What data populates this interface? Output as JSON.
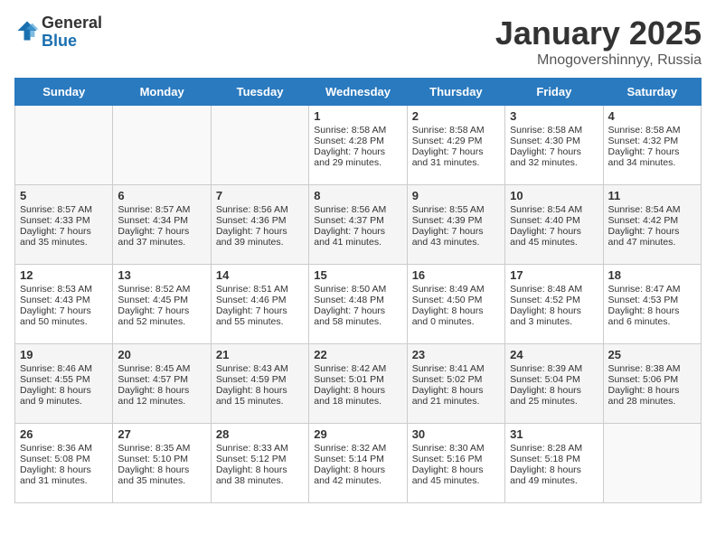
{
  "header": {
    "logo": {
      "general": "General",
      "blue": "Blue"
    },
    "title": "January 2025",
    "subtitle": "Mnogovershinnyy, Russia"
  },
  "weekdays": [
    "Sunday",
    "Monday",
    "Tuesday",
    "Wednesday",
    "Thursday",
    "Friday",
    "Saturday"
  ],
  "weeks": [
    [
      {
        "day": "",
        "content": ""
      },
      {
        "day": "",
        "content": ""
      },
      {
        "day": "",
        "content": ""
      },
      {
        "day": "1",
        "content": "Sunrise: 8:58 AM\nSunset: 4:28 PM\nDaylight: 7 hours and 29 minutes."
      },
      {
        "day": "2",
        "content": "Sunrise: 8:58 AM\nSunset: 4:29 PM\nDaylight: 7 hours and 31 minutes."
      },
      {
        "day": "3",
        "content": "Sunrise: 8:58 AM\nSunset: 4:30 PM\nDaylight: 7 hours and 32 minutes."
      },
      {
        "day": "4",
        "content": "Sunrise: 8:58 AM\nSunset: 4:32 PM\nDaylight: 7 hours and 34 minutes."
      }
    ],
    [
      {
        "day": "5",
        "content": "Sunrise: 8:57 AM\nSunset: 4:33 PM\nDaylight: 7 hours and 35 minutes."
      },
      {
        "day": "6",
        "content": "Sunrise: 8:57 AM\nSunset: 4:34 PM\nDaylight: 7 hours and 37 minutes."
      },
      {
        "day": "7",
        "content": "Sunrise: 8:56 AM\nSunset: 4:36 PM\nDaylight: 7 hours and 39 minutes."
      },
      {
        "day": "8",
        "content": "Sunrise: 8:56 AM\nSunset: 4:37 PM\nDaylight: 7 hours and 41 minutes."
      },
      {
        "day": "9",
        "content": "Sunrise: 8:55 AM\nSunset: 4:39 PM\nDaylight: 7 hours and 43 minutes."
      },
      {
        "day": "10",
        "content": "Sunrise: 8:54 AM\nSunset: 4:40 PM\nDaylight: 7 hours and 45 minutes."
      },
      {
        "day": "11",
        "content": "Sunrise: 8:54 AM\nSunset: 4:42 PM\nDaylight: 7 hours and 47 minutes."
      }
    ],
    [
      {
        "day": "12",
        "content": "Sunrise: 8:53 AM\nSunset: 4:43 PM\nDaylight: 7 hours and 50 minutes."
      },
      {
        "day": "13",
        "content": "Sunrise: 8:52 AM\nSunset: 4:45 PM\nDaylight: 7 hours and 52 minutes."
      },
      {
        "day": "14",
        "content": "Sunrise: 8:51 AM\nSunset: 4:46 PM\nDaylight: 7 hours and 55 minutes."
      },
      {
        "day": "15",
        "content": "Sunrise: 8:50 AM\nSunset: 4:48 PM\nDaylight: 7 hours and 58 minutes."
      },
      {
        "day": "16",
        "content": "Sunrise: 8:49 AM\nSunset: 4:50 PM\nDaylight: 8 hours and 0 minutes."
      },
      {
        "day": "17",
        "content": "Sunrise: 8:48 AM\nSunset: 4:52 PM\nDaylight: 8 hours and 3 minutes."
      },
      {
        "day": "18",
        "content": "Sunrise: 8:47 AM\nSunset: 4:53 PM\nDaylight: 8 hours and 6 minutes."
      }
    ],
    [
      {
        "day": "19",
        "content": "Sunrise: 8:46 AM\nSunset: 4:55 PM\nDaylight: 8 hours and 9 minutes."
      },
      {
        "day": "20",
        "content": "Sunrise: 8:45 AM\nSunset: 4:57 PM\nDaylight: 8 hours and 12 minutes."
      },
      {
        "day": "21",
        "content": "Sunrise: 8:43 AM\nSunset: 4:59 PM\nDaylight: 8 hours and 15 minutes."
      },
      {
        "day": "22",
        "content": "Sunrise: 8:42 AM\nSunset: 5:01 PM\nDaylight: 8 hours and 18 minutes."
      },
      {
        "day": "23",
        "content": "Sunrise: 8:41 AM\nSunset: 5:02 PM\nDaylight: 8 hours and 21 minutes."
      },
      {
        "day": "24",
        "content": "Sunrise: 8:39 AM\nSunset: 5:04 PM\nDaylight: 8 hours and 25 minutes."
      },
      {
        "day": "25",
        "content": "Sunrise: 8:38 AM\nSunset: 5:06 PM\nDaylight: 8 hours and 28 minutes."
      }
    ],
    [
      {
        "day": "26",
        "content": "Sunrise: 8:36 AM\nSunset: 5:08 PM\nDaylight: 8 hours and 31 minutes."
      },
      {
        "day": "27",
        "content": "Sunrise: 8:35 AM\nSunset: 5:10 PM\nDaylight: 8 hours and 35 minutes."
      },
      {
        "day": "28",
        "content": "Sunrise: 8:33 AM\nSunset: 5:12 PM\nDaylight: 8 hours and 38 minutes."
      },
      {
        "day": "29",
        "content": "Sunrise: 8:32 AM\nSunset: 5:14 PM\nDaylight: 8 hours and 42 minutes."
      },
      {
        "day": "30",
        "content": "Sunrise: 8:30 AM\nSunset: 5:16 PM\nDaylight: 8 hours and 45 minutes."
      },
      {
        "day": "31",
        "content": "Sunrise: 8:28 AM\nSunset: 5:18 PM\nDaylight: 8 hours and 49 minutes."
      },
      {
        "day": "",
        "content": ""
      }
    ]
  ]
}
